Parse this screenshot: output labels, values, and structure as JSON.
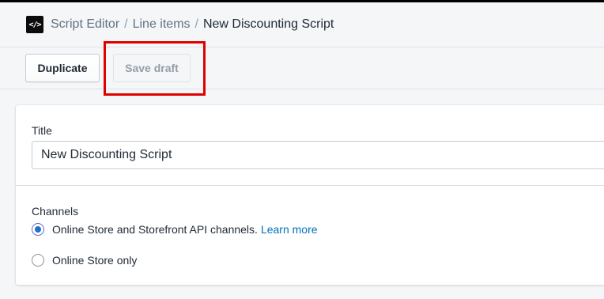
{
  "header": {
    "app_icon_text": "</>",
    "breadcrumb": [
      "Script Editor",
      "Line items"
    ],
    "current_page": "New Discounting Script",
    "separator": "/"
  },
  "toolbar": {
    "duplicate_label": "Duplicate",
    "save_draft_label": "Save draft",
    "save_draft_disabled": true
  },
  "form": {
    "title_label": "Title",
    "title_value": "New Discounting Script",
    "channels_label": "Channels",
    "channel_options": [
      {
        "label": "Online Store and Storefront API channels.",
        "link": "Learn more",
        "checked": true
      },
      {
        "label": "Online Store only",
        "checked": false
      }
    ]
  },
  "colors": {
    "highlight": "#e00000",
    "link": "#006fbb",
    "radio_selected": "#1f6fcf"
  }
}
